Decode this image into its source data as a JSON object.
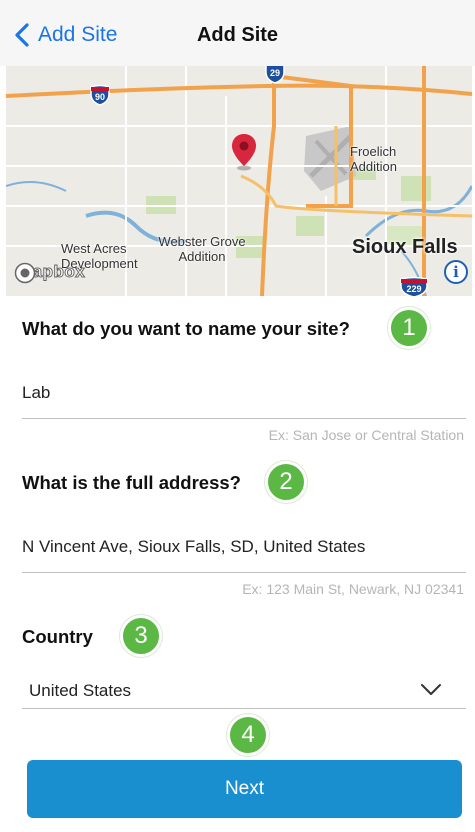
{
  "navbar": {
    "back_label": "Add Site",
    "title": "Add Site"
  },
  "map": {
    "labels": {
      "froelich": "Froelich Addition",
      "west_acres": "West Acres Development",
      "webster": "Webster Grove Addition",
      "city": "Sioux Falls"
    },
    "highways": {
      "i29": "29",
      "i90": "90",
      "i229": "229"
    },
    "attribution": "mapbox",
    "info_glyph": "i"
  },
  "form": {
    "name": {
      "question": "What do you want to name your site?",
      "step": "1",
      "value": "Lab",
      "hint": "Ex: San Jose or Central Station"
    },
    "address": {
      "question": "What is the full address?",
      "step": "2",
      "value": "N Vincent Ave, Sioux Falls, SD, United States",
      "hint": "Ex: 123 Main St, Newark, NJ 02341"
    },
    "country": {
      "label": "Country",
      "step": "3",
      "value": "United States"
    },
    "next": {
      "step": "4",
      "label": "Next"
    }
  },
  "colors": {
    "accent": "#1a75e8",
    "button": "#1a8fd0",
    "badge": "#5bb844",
    "pin": "#d7263d"
  }
}
